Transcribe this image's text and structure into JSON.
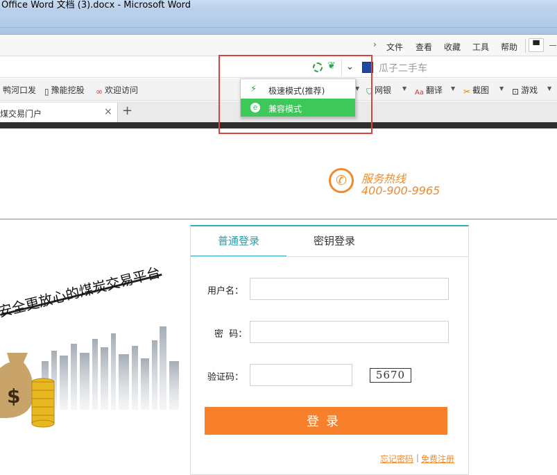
{
  "window": {
    "title": "Office Word 文档 (3).docx - Microsoft Word"
  },
  "menu": {
    "items": [
      "文件",
      "查看",
      "收藏",
      "工具",
      "帮助"
    ]
  },
  "address_bar": {
    "search_text": "瓜子二手车"
  },
  "mode_dropdown": {
    "fast_mode": "极速模式(推荐)",
    "compat_mode": "兼容模式",
    "highlight_color": "#d9433f"
  },
  "bookmarks": {
    "items": [
      "鸭河口发",
      "豫能挖股",
      "欢迎访问",
      "网银",
      "翻译",
      "截图",
      "游戏"
    ]
  },
  "tabs": {
    "active_label": "煤交易门户",
    "add_label": "+",
    "close_label": "×"
  },
  "hotline": {
    "title": "服务热线",
    "number": "400-900-9965"
  },
  "banner": {
    "slogan": "安全更放心的煤炭交易平台"
  },
  "login": {
    "tab_normal": "普通登录",
    "tab_key": "密钥登录",
    "username_label": "用户名：",
    "password_label": "密  码：",
    "captcha_label": "验证码：",
    "captcha_text": "5670",
    "submit_label": "登录",
    "forgot_link": "忘记密码",
    "separator": "|",
    "register_link": "免费注册"
  },
  "colors": {
    "accent_teal": "#3aa9b8",
    "accent_orange": "#f8802a",
    "compat_green": "#3ec85a"
  }
}
